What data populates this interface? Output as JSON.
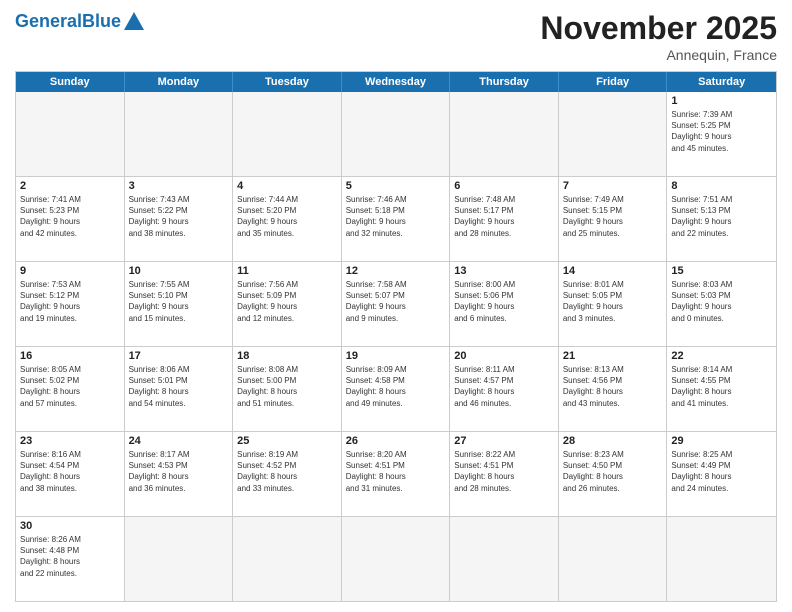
{
  "header": {
    "logo_general": "General",
    "logo_blue": "Blue",
    "title": "November 2025",
    "location": "Annequin, France"
  },
  "weekdays": [
    "Sunday",
    "Monday",
    "Tuesday",
    "Wednesday",
    "Thursday",
    "Friday",
    "Saturday"
  ],
  "rows": [
    [
      {
        "day": "",
        "info": "",
        "empty": true
      },
      {
        "day": "",
        "info": "",
        "empty": true
      },
      {
        "day": "",
        "info": "",
        "empty": true
      },
      {
        "day": "",
        "info": "",
        "empty": true
      },
      {
        "day": "",
        "info": "",
        "empty": true
      },
      {
        "day": "",
        "info": "",
        "empty": true
      },
      {
        "day": "1",
        "info": "Sunrise: 7:39 AM\nSunset: 5:25 PM\nDaylight: 9 hours\nand 45 minutes.",
        "empty": false
      }
    ],
    [
      {
        "day": "2",
        "info": "Sunrise: 7:41 AM\nSunset: 5:23 PM\nDaylight: 9 hours\nand 42 minutes.",
        "empty": false
      },
      {
        "day": "3",
        "info": "Sunrise: 7:43 AM\nSunset: 5:22 PM\nDaylight: 9 hours\nand 38 minutes.",
        "empty": false
      },
      {
        "day": "4",
        "info": "Sunrise: 7:44 AM\nSunset: 5:20 PM\nDaylight: 9 hours\nand 35 minutes.",
        "empty": false
      },
      {
        "day": "5",
        "info": "Sunrise: 7:46 AM\nSunset: 5:18 PM\nDaylight: 9 hours\nand 32 minutes.",
        "empty": false
      },
      {
        "day": "6",
        "info": "Sunrise: 7:48 AM\nSunset: 5:17 PM\nDaylight: 9 hours\nand 28 minutes.",
        "empty": false
      },
      {
        "day": "7",
        "info": "Sunrise: 7:49 AM\nSunset: 5:15 PM\nDaylight: 9 hours\nand 25 minutes.",
        "empty": false
      },
      {
        "day": "8",
        "info": "Sunrise: 7:51 AM\nSunset: 5:13 PM\nDaylight: 9 hours\nand 22 minutes.",
        "empty": false
      }
    ],
    [
      {
        "day": "9",
        "info": "Sunrise: 7:53 AM\nSunset: 5:12 PM\nDaylight: 9 hours\nand 19 minutes.",
        "empty": false
      },
      {
        "day": "10",
        "info": "Sunrise: 7:55 AM\nSunset: 5:10 PM\nDaylight: 9 hours\nand 15 minutes.",
        "empty": false
      },
      {
        "day": "11",
        "info": "Sunrise: 7:56 AM\nSunset: 5:09 PM\nDaylight: 9 hours\nand 12 minutes.",
        "empty": false
      },
      {
        "day": "12",
        "info": "Sunrise: 7:58 AM\nSunset: 5:07 PM\nDaylight: 9 hours\nand 9 minutes.",
        "empty": false
      },
      {
        "day": "13",
        "info": "Sunrise: 8:00 AM\nSunset: 5:06 PM\nDaylight: 9 hours\nand 6 minutes.",
        "empty": false
      },
      {
        "day": "14",
        "info": "Sunrise: 8:01 AM\nSunset: 5:05 PM\nDaylight: 9 hours\nand 3 minutes.",
        "empty": false
      },
      {
        "day": "15",
        "info": "Sunrise: 8:03 AM\nSunset: 5:03 PM\nDaylight: 9 hours\nand 0 minutes.",
        "empty": false
      }
    ],
    [
      {
        "day": "16",
        "info": "Sunrise: 8:05 AM\nSunset: 5:02 PM\nDaylight: 8 hours\nand 57 minutes.",
        "empty": false
      },
      {
        "day": "17",
        "info": "Sunrise: 8:06 AM\nSunset: 5:01 PM\nDaylight: 8 hours\nand 54 minutes.",
        "empty": false
      },
      {
        "day": "18",
        "info": "Sunrise: 8:08 AM\nSunset: 5:00 PM\nDaylight: 8 hours\nand 51 minutes.",
        "empty": false
      },
      {
        "day": "19",
        "info": "Sunrise: 8:09 AM\nSunset: 4:58 PM\nDaylight: 8 hours\nand 49 minutes.",
        "empty": false
      },
      {
        "day": "20",
        "info": "Sunrise: 8:11 AM\nSunset: 4:57 PM\nDaylight: 8 hours\nand 46 minutes.",
        "empty": false
      },
      {
        "day": "21",
        "info": "Sunrise: 8:13 AM\nSunset: 4:56 PM\nDaylight: 8 hours\nand 43 minutes.",
        "empty": false
      },
      {
        "day": "22",
        "info": "Sunrise: 8:14 AM\nSunset: 4:55 PM\nDaylight: 8 hours\nand 41 minutes.",
        "empty": false
      }
    ],
    [
      {
        "day": "23",
        "info": "Sunrise: 8:16 AM\nSunset: 4:54 PM\nDaylight: 8 hours\nand 38 minutes.",
        "empty": false
      },
      {
        "day": "24",
        "info": "Sunrise: 8:17 AM\nSunset: 4:53 PM\nDaylight: 8 hours\nand 36 minutes.",
        "empty": false
      },
      {
        "day": "25",
        "info": "Sunrise: 8:19 AM\nSunset: 4:52 PM\nDaylight: 8 hours\nand 33 minutes.",
        "empty": false
      },
      {
        "day": "26",
        "info": "Sunrise: 8:20 AM\nSunset: 4:51 PM\nDaylight: 8 hours\nand 31 minutes.",
        "empty": false
      },
      {
        "day": "27",
        "info": "Sunrise: 8:22 AM\nSunset: 4:51 PM\nDaylight: 8 hours\nand 28 minutes.",
        "empty": false
      },
      {
        "day": "28",
        "info": "Sunrise: 8:23 AM\nSunset: 4:50 PM\nDaylight: 8 hours\nand 26 minutes.",
        "empty": false
      },
      {
        "day": "29",
        "info": "Sunrise: 8:25 AM\nSunset: 4:49 PM\nDaylight: 8 hours\nand 24 minutes.",
        "empty": false
      }
    ],
    [
      {
        "day": "30",
        "info": "Sunrise: 8:26 AM\nSunset: 4:48 PM\nDaylight: 8 hours\nand 22 minutes.",
        "empty": false
      },
      {
        "day": "",
        "info": "",
        "empty": true
      },
      {
        "day": "",
        "info": "",
        "empty": true
      },
      {
        "day": "",
        "info": "",
        "empty": true
      },
      {
        "day": "",
        "info": "",
        "empty": true
      },
      {
        "day": "",
        "info": "",
        "empty": true
      },
      {
        "day": "",
        "info": "",
        "empty": true
      }
    ]
  ]
}
